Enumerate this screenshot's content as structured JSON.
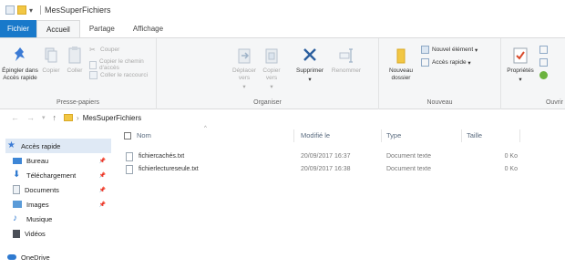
{
  "window": {
    "title": "MesSuperFichiers"
  },
  "tabs": [
    {
      "label": "Fichier"
    },
    {
      "label": "Accueil"
    },
    {
      "label": "Partage"
    },
    {
      "label": "Affichage"
    }
  ],
  "ribbon": {
    "presse_papiers": {
      "label": "Presse-papiers",
      "epingler": "Épingler dans Accès rapide",
      "copier": "Copier",
      "coller": "Coller",
      "couper": "Couper",
      "copier_chemin": "Copier le chemin d'accès",
      "coller_raccourci": "Coller le raccourci"
    },
    "organiser": {
      "label": "Organiser",
      "deplacer": "Déplacer vers",
      "copier_vers": "Copier vers",
      "supprimer": "Supprimer",
      "renommer": "Renommer"
    },
    "nouveau": {
      "label": "Nouveau",
      "nouveau_dossier": "Nouveau dossier",
      "nouvel_element": "Nouvel élément",
      "acces_facile": "Accès rapide"
    },
    "ouvrir": {
      "label": "Ouvrir",
      "proprietes": "Propriétés"
    }
  },
  "address": {
    "path": "MesSuperFichiers"
  },
  "nav": {
    "acces_rapide": "Accès rapide",
    "items": [
      {
        "label": "Bureau"
      },
      {
        "label": "Téléchargement"
      },
      {
        "label": "Documents"
      },
      {
        "label": "Images"
      },
      {
        "label": "Musique"
      },
      {
        "label": "Vidéos"
      }
    ],
    "onedrive": "OneDrive"
  },
  "columns": {
    "nom": "Nom",
    "modifie": "Modifié le",
    "type": "Type",
    "taille": "Taille"
  },
  "files": [
    {
      "name": "fichiercachés.txt",
      "modified": "20/09/2017 16:37",
      "type": "Document texte",
      "size": "0 Ko"
    },
    {
      "name": "fichierlectureseule.txt",
      "modified": "20/09/2017 16:38",
      "type": "Document texte",
      "size": "0 Ko"
    }
  ],
  "colors": {
    "file_tab": "#1979ca",
    "folder": "#f2c744",
    "selection": "#dfe9f5"
  }
}
